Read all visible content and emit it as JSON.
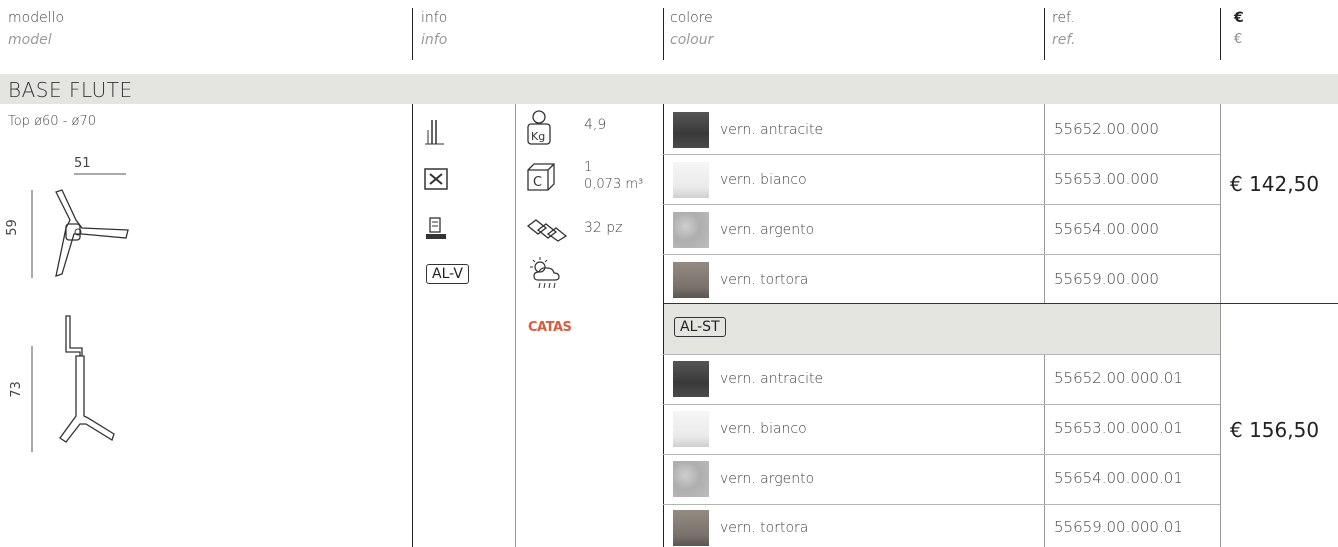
{
  "header": {
    "model_it": "modello",
    "model_en": "model",
    "info_it": "info",
    "info_en": "info",
    "colour_it": "colore",
    "colour_en": "colour",
    "ref_it": "ref.",
    "ref_en": "ref.",
    "price_it": "€",
    "price_en": "€"
  },
  "section": {
    "title": "BASE FLUTE",
    "top_label": "Top  ø60 - ø70",
    "dim_width": "51",
    "dim_depth": "59",
    "dim_height": "73"
  },
  "info": {
    "weight": "4,9",
    "packaging_count": "1",
    "packaging_volume": "0,073 m³",
    "pallet": "32 pz",
    "material_code": "AL-V",
    "catas_logo_text": "CATAS"
  },
  "groups": [
    {
      "rows": [
        {
          "colour": "vern. antracite",
          "ref": "55652.00.000",
          "swatch": "antracite"
        },
        {
          "colour": "vern. bianco",
          "ref": "55653.00.000",
          "swatch": "bianco"
        },
        {
          "colour": "vern. argento",
          "ref": "55654.00.000",
          "swatch": "argento"
        },
        {
          "colour": "vern. tortora",
          "ref": "55659.00.000",
          "swatch": "tortora"
        }
      ],
      "price": "€ 142,50"
    },
    {
      "label": "AL-ST",
      "rows": [
        {
          "colour": "vern. antracite",
          "ref": "55652.00.000.01",
          "swatch": "antracite"
        },
        {
          "colour": "vern. bianco",
          "ref": "55653.00.000.01",
          "swatch": "bianco"
        },
        {
          "colour": "vern. argento",
          "ref": "55654.00.000.01",
          "swatch": "argento"
        },
        {
          "colour": "vern. tortora",
          "ref": "55659.00.000.01",
          "swatch": "tortora"
        }
      ],
      "price": "€ 156,50"
    }
  ],
  "colors": {
    "band": "#e4e4e1",
    "antracite": "#3f3f3f",
    "bianco": "#efefef",
    "argento": "#b8b8b8",
    "tortora": "#837a73",
    "catas": "#e05a3a"
  }
}
